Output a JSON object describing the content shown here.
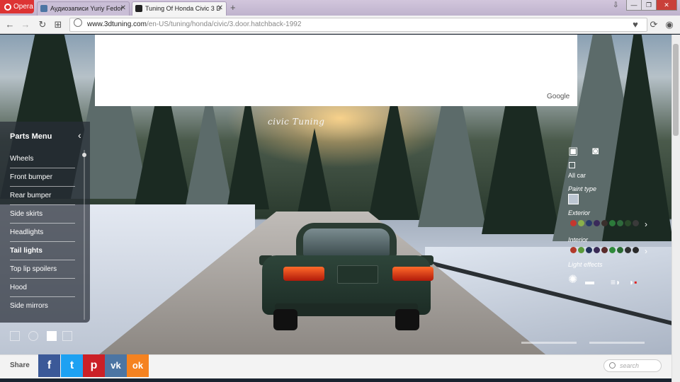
{
  "browser": {
    "menu_label": "Opera",
    "tabs": [
      {
        "label": "Аудиозаписи Yuriy Fedor"
      },
      {
        "label": "Tuning Of Honda Civic 3 D"
      }
    ],
    "new_tab_symbol": "+",
    "url_host": "www.3dtuning.com",
    "url_path": "/en-US/tuning/honda/civic/3.door.hatchback-1992"
  },
  "ad": {
    "provider": "Google"
  },
  "brand": "civic   Tuning",
  "parts_menu": {
    "title": "Parts Menu",
    "items": [
      {
        "label": "Wheels"
      },
      {
        "label": "Front bumper"
      },
      {
        "label": "Rear bumper"
      },
      {
        "label": "Side skirts"
      },
      {
        "label": "Headlights"
      },
      {
        "label": "Tail lights",
        "active": true
      },
      {
        "label": "Top lip spoilers"
      },
      {
        "label": "Hood"
      },
      {
        "label": "Side mirrors"
      }
    ]
  },
  "right_panel": {
    "all_car_label": "All car",
    "paint_type_label": "Paint type",
    "exterior_label": "Exterior",
    "interior_label": "Interior",
    "light_effects_label": "Light effects",
    "exterior_colors": [
      "#c4372f",
      "#8ab04a",
      "#2a3a6a",
      "#3a2a5a",
      "#3a2f2c",
      "#2c7a3a",
      "#2f6a3c",
      "#2a4a2a",
      "#3a3a3a"
    ],
    "interior_colors": [
      "#b23a2a",
      "#5a9a3a",
      "#22305a",
      "#3a2a55",
      "#5a2a2a",
      "#2e8a3a",
      "#2a6a32",
      "#303030",
      "#2a2a2a"
    ]
  },
  "bottom": {
    "share_label": "Share",
    "search_placeholder": "search",
    "share_buttons": [
      {
        "network": "facebook",
        "glyph": "f",
        "color": "#3b5998"
      },
      {
        "network": "twitter",
        "glyph": "t",
        "color": "#1da1f2"
      },
      {
        "network": "pinterest",
        "glyph": "p",
        "color": "#cb2027"
      },
      {
        "network": "vk",
        "glyph": "vk",
        "color": "#4c75a3"
      },
      {
        "network": "odnoklassniki",
        "glyph": "ok",
        "color": "#f58220"
      }
    ]
  }
}
